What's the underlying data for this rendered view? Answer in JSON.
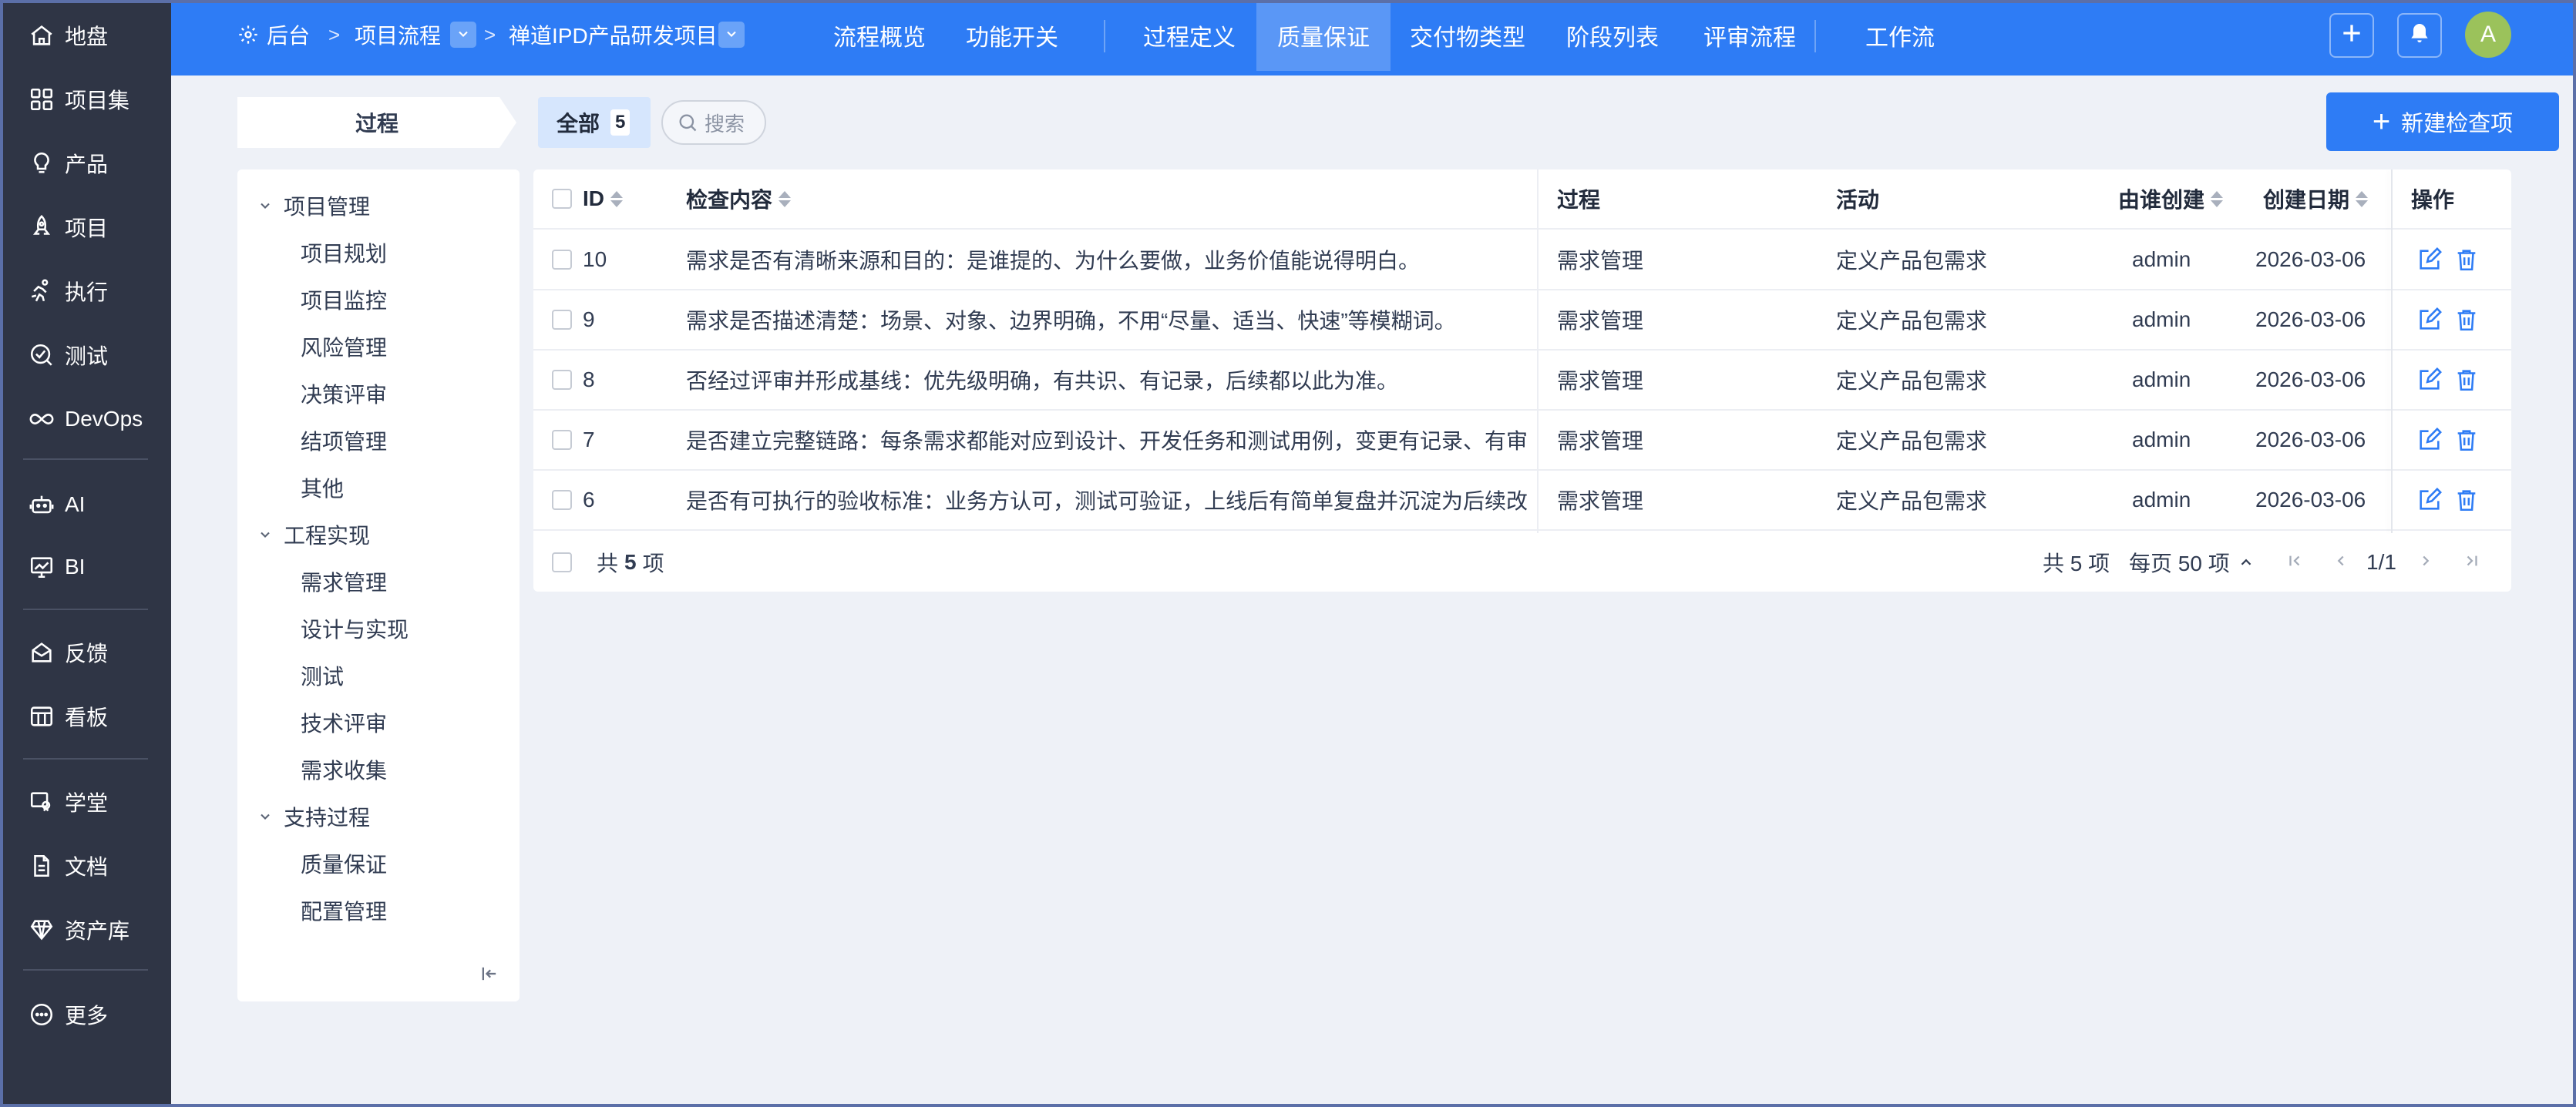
{
  "sidebar": {
    "items": [
      {
        "label": "地盘",
        "icon": "home-icon"
      },
      {
        "label": "项目集",
        "icon": "grid-icon"
      },
      {
        "label": "产品",
        "icon": "bulb-icon"
      },
      {
        "label": "项目",
        "icon": "rocket-icon"
      },
      {
        "label": "执行",
        "icon": "run-icon"
      },
      {
        "label": "测试",
        "icon": "test-icon"
      },
      {
        "label": "DevOps",
        "icon": "infinity-icon"
      },
      {
        "label": "AI",
        "icon": "robot-icon"
      },
      {
        "label": "BI",
        "icon": "chart-icon"
      },
      {
        "label": "反馈",
        "icon": "feedback-icon"
      },
      {
        "label": "看板",
        "icon": "board-icon"
      },
      {
        "label": "学堂",
        "icon": "school-icon"
      },
      {
        "label": "文档",
        "icon": "document-icon"
      },
      {
        "label": "资产库",
        "icon": "diamond-icon"
      },
      {
        "label": "更多",
        "icon": "more-icon"
      }
    ]
  },
  "topbar": {
    "breadcrumb": {
      "home": "后台",
      "sep": ">",
      "module": "项目流程",
      "project": "禅道IPD产品研发项目"
    },
    "tabs": [
      {
        "label": "流程概览",
        "active": false
      },
      {
        "label": "功能开关",
        "active": false
      },
      {
        "label": "过程定义",
        "active": false
      },
      {
        "label": "质量保证",
        "active": true
      },
      {
        "label": "交付物类型",
        "active": false
      },
      {
        "label": "阶段列表",
        "active": false
      },
      {
        "label": "评审流程",
        "active": false
      },
      {
        "label": "工作流",
        "active": false
      }
    ],
    "avatar_letter": "A"
  },
  "toolbar": {
    "process_label": "过程",
    "all_label": "全部",
    "all_count": "5",
    "search_placeholder": "搜索",
    "create_label": "新建检查项"
  },
  "tree": {
    "groups": [
      {
        "label": "项目管理",
        "children": [
          "项目规划",
          "项目监控",
          "风险管理",
          "决策评审",
          "结项管理",
          "其他"
        ]
      },
      {
        "label": "工程实现",
        "children": [
          "需求管理",
          "设计与实现",
          "测试",
          "技术评审",
          "需求收集"
        ]
      },
      {
        "label": "支持过程",
        "children": [
          "质量保证",
          "配置管理"
        ]
      }
    ]
  },
  "table": {
    "columns": {
      "id": "ID",
      "content": "检查内容",
      "process": "过程",
      "activity": "活动",
      "creator": "由谁创建",
      "date": "创建日期",
      "actions": "操作"
    },
    "rows": [
      {
        "id": "10",
        "content": "需求是否有清晰来源和目的：是谁提的、为什么要做，业务价值能说得明白。",
        "process": "需求管理",
        "activity": "定义产品包需求",
        "creator": "admin",
        "date": "2026-03-06"
      },
      {
        "id": "9",
        "content": "需求是否描述清楚：场景、对象、边界明确，不用“尽量、适当、快速”等模糊词。",
        "process": "需求管理",
        "activity": "定义产品包需求",
        "creator": "admin",
        "date": "2026-03-06"
      },
      {
        "id": "8",
        "content": "否经过评审并形成基线：优先级明确，有共识、有记录，后续都以此为准。",
        "process": "需求管理",
        "activity": "定义产品包需求",
        "creator": "admin",
        "date": "2026-03-06"
      },
      {
        "id": "7",
        "content": "是否建立完整链路：每条需求都能对应到设计、开发任务和测试用例，变更有记录、有审",
        "process": "需求管理",
        "activity": "定义产品包需求",
        "creator": "admin",
        "date": "2026-03-06"
      },
      {
        "id": "6",
        "content": "是否有可执行的验收标准：业务方认可，测试可验证，上线后有简单复盘并沉淀为后续改",
        "process": "需求管理",
        "activity": "定义产品包需求",
        "creator": "admin",
        "date": "2026-03-06"
      }
    ],
    "footer": {
      "total_prefix": "共",
      "total_count": "5",
      "total_suffix": "项",
      "summary": "共 5 项",
      "per_page": "每页 50 项",
      "page": "1/1"
    }
  },
  "colors": {
    "sidebar_bg": "#2f3545",
    "topbar_bg": "#2e7cf5",
    "active_tab_bg": "#5a97f6",
    "accent": "#2e7cf5",
    "page_bg": "#eef1f7"
  }
}
